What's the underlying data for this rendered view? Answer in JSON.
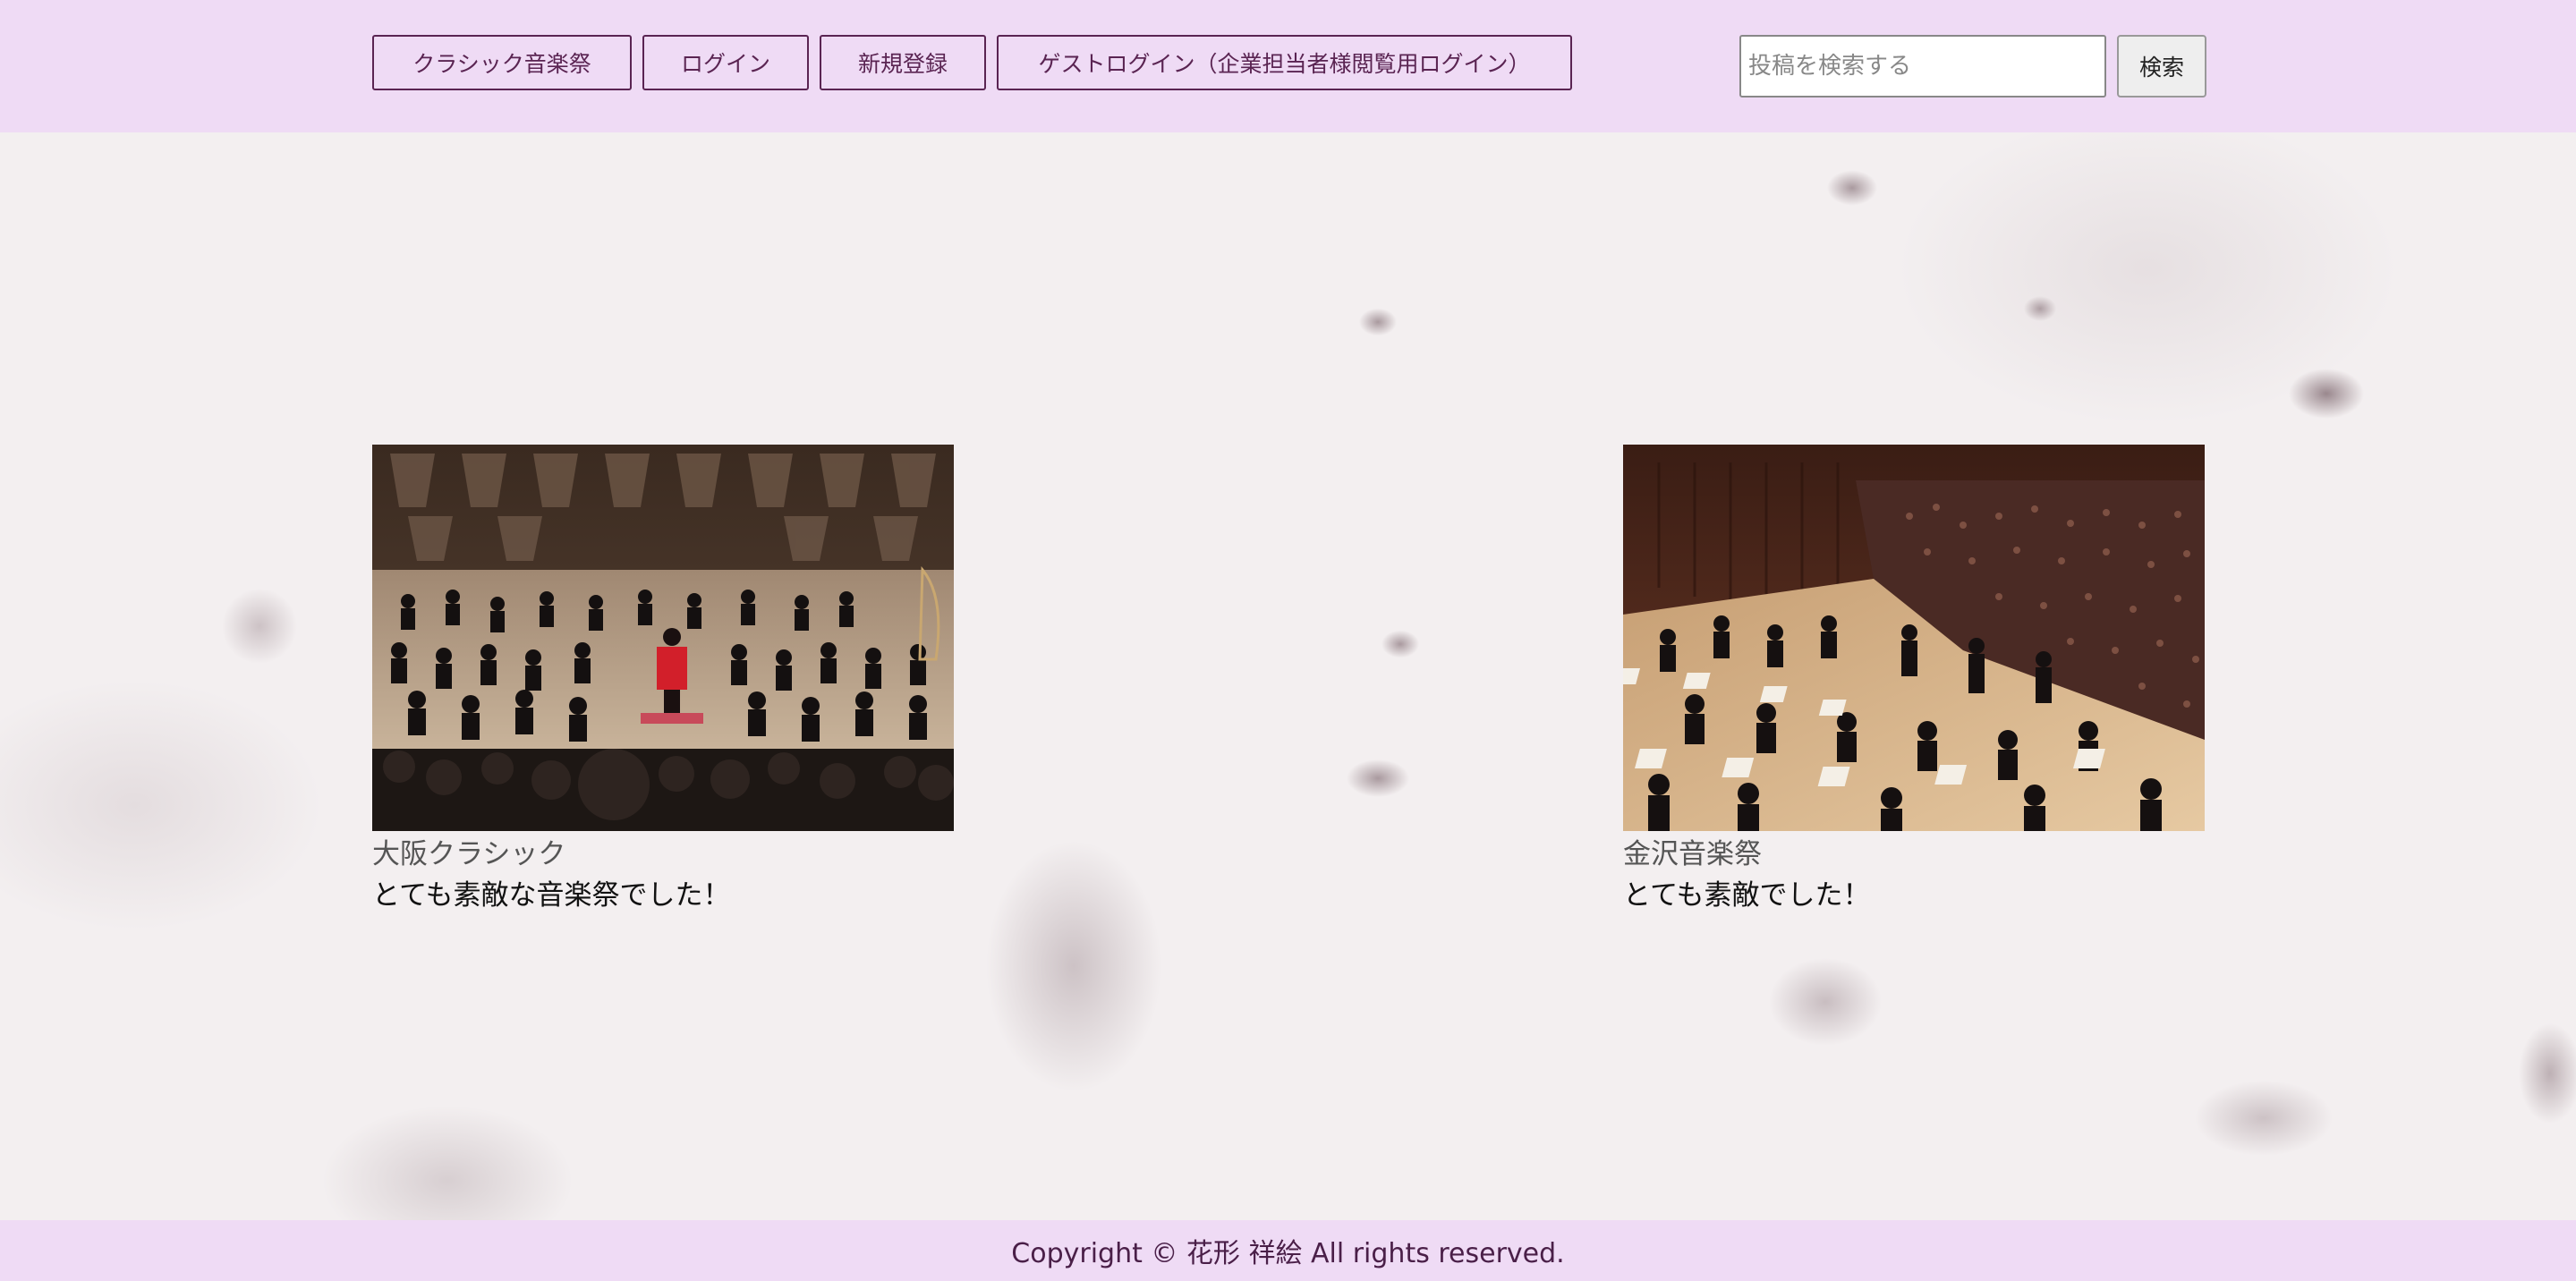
{
  "header": {
    "nav": {
      "classic_label": "クラシック音楽祭",
      "login_label": "ログイン",
      "signup_label": "新規登録",
      "guest_label": "ゲストログイン（企業担当者様閲覧用ログイン）"
    },
    "search": {
      "placeholder": "投稿を検索する",
      "value": "",
      "button_label": "検索"
    }
  },
  "posts": [
    {
      "title": "大阪クラシック",
      "body": "とても素敵な音楽祭でした！",
      "image": "orchestra-stage-photo"
    },
    {
      "title": "金沢音楽祭",
      "body": "とても素敵でした！",
      "image": "concert-hall-photo"
    }
  ],
  "footer": {
    "copyright": "Copyright © 花形 祥絵 All rights reserved."
  },
  "colors": {
    "header_bg": "#efdbf5",
    "accent": "#5a2452",
    "footer_text": "#4a1f48"
  }
}
